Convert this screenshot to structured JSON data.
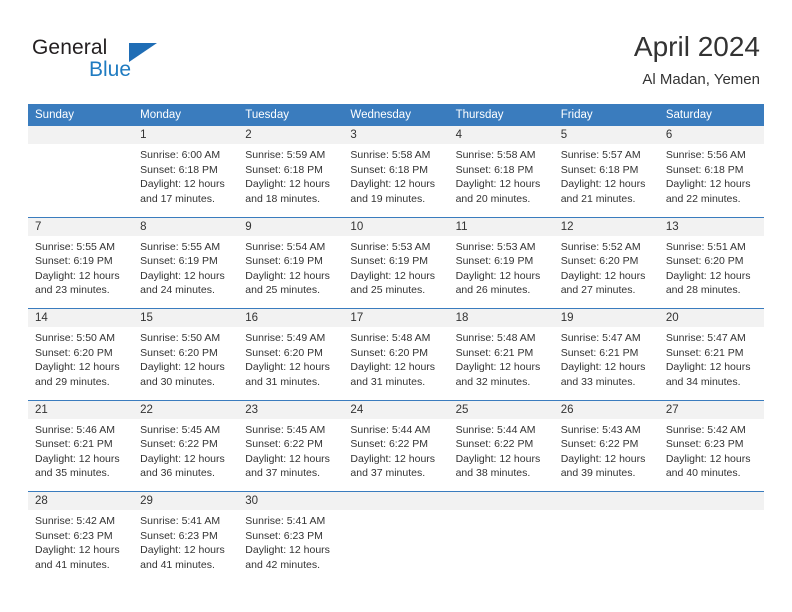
{
  "brand": {
    "name_part1": "General",
    "name_part2": "Blue"
  },
  "header": {
    "title": "April 2024",
    "subtitle": "Al Madan, Yemen"
  },
  "colors": {
    "header_blue": "#3a7cbe",
    "date_strip": "#f2f2f2",
    "logo_blue": "#1f7bc1",
    "text": "#333333"
  },
  "weekday_headers": [
    "Sunday",
    "Monday",
    "Tuesday",
    "Wednesday",
    "Thursday",
    "Friday",
    "Saturday"
  ],
  "labels": {
    "sunrise_prefix": "Sunrise:",
    "sunset_prefix": "Sunset:",
    "daylight_prefix": "Daylight:"
  },
  "weeks": [
    {
      "days": [
        {
          "date": "",
          "sunrise": "",
          "sunset": "",
          "daylight": ""
        },
        {
          "date": "1",
          "sunrise": "Sunrise: 6:00 AM",
          "sunset": "Sunset: 6:18 PM",
          "daylight": "Daylight: 12 hours and 17 minutes."
        },
        {
          "date": "2",
          "sunrise": "Sunrise: 5:59 AM",
          "sunset": "Sunset: 6:18 PM",
          "daylight": "Daylight: 12 hours and 18 minutes."
        },
        {
          "date": "3",
          "sunrise": "Sunrise: 5:58 AM",
          "sunset": "Sunset: 6:18 PM",
          "daylight": "Daylight: 12 hours and 19 minutes."
        },
        {
          "date": "4",
          "sunrise": "Sunrise: 5:58 AM",
          "sunset": "Sunset: 6:18 PM",
          "daylight": "Daylight: 12 hours and 20 minutes."
        },
        {
          "date": "5",
          "sunrise": "Sunrise: 5:57 AM",
          "sunset": "Sunset: 6:18 PM",
          "daylight": "Daylight: 12 hours and 21 minutes."
        },
        {
          "date": "6",
          "sunrise": "Sunrise: 5:56 AM",
          "sunset": "Sunset: 6:18 PM",
          "daylight": "Daylight: 12 hours and 22 minutes."
        }
      ]
    },
    {
      "days": [
        {
          "date": "7",
          "sunrise": "Sunrise: 5:55 AM",
          "sunset": "Sunset: 6:19 PM",
          "daylight": "Daylight: 12 hours and 23 minutes."
        },
        {
          "date": "8",
          "sunrise": "Sunrise: 5:55 AM",
          "sunset": "Sunset: 6:19 PM",
          "daylight": "Daylight: 12 hours and 24 minutes."
        },
        {
          "date": "9",
          "sunrise": "Sunrise: 5:54 AM",
          "sunset": "Sunset: 6:19 PM",
          "daylight": "Daylight: 12 hours and 25 minutes."
        },
        {
          "date": "10",
          "sunrise": "Sunrise: 5:53 AM",
          "sunset": "Sunset: 6:19 PM",
          "daylight": "Daylight: 12 hours and 25 minutes."
        },
        {
          "date": "11",
          "sunrise": "Sunrise: 5:53 AM",
          "sunset": "Sunset: 6:19 PM",
          "daylight": "Daylight: 12 hours and 26 minutes."
        },
        {
          "date": "12",
          "sunrise": "Sunrise: 5:52 AM",
          "sunset": "Sunset: 6:20 PM",
          "daylight": "Daylight: 12 hours and 27 minutes."
        },
        {
          "date": "13",
          "sunrise": "Sunrise: 5:51 AM",
          "sunset": "Sunset: 6:20 PM",
          "daylight": "Daylight: 12 hours and 28 minutes."
        }
      ]
    },
    {
      "days": [
        {
          "date": "14",
          "sunrise": "Sunrise: 5:50 AM",
          "sunset": "Sunset: 6:20 PM",
          "daylight": "Daylight: 12 hours and 29 minutes."
        },
        {
          "date": "15",
          "sunrise": "Sunrise: 5:50 AM",
          "sunset": "Sunset: 6:20 PM",
          "daylight": "Daylight: 12 hours and 30 minutes."
        },
        {
          "date": "16",
          "sunrise": "Sunrise: 5:49 AM",
          "sunset": "Sunset: 6:20 PM",
          "daylight": "Daylight: 12 hours and 31 minutes."
        },
        {
          "date": "17",
          "sunrise": "Sunrise: 5:48 AM",
          "sunset": "Sunset: 6:20 PM",
          "daylight": "Daylight: 12 hours and 31 minutes."
        },
        {
          "date": "18",
          "sunrise": "Sunrise: 5:48 AM",
          "sunset": "Sunset: 6:21 PM",
          "daylight": "Daylight: 12 hours and 32 minutes."
        },
        {
          "date": "19",
          "sunrise": "Sunrise: 5:47 AM",
          "sunset": "Sunset: 6:21 PM",
          "daylight": "Daylight: 12 hours and 33 minutes."
        },
        {
          "date": "20",
          "sunrise": "Sunrise: 5:47 AM",
          "sunset": "Sunset: 6:21 PM",
          "daylight": "Daylight: 12 hours and 34 minutes."
        }
      ]
    },
    {
      "days": [
        {
          "date": "21",
          "sunrise": "Sunrise: 5:46 AM",
          "sunset": "Sunset: 6:21 PM",
          "daylight": "Daylight: 12 hours and 35 minutes."
        },
        {
          "date": "22",
          "sunrise": "Sunrise: 5:45 AM",
          "sunset": "Sunset: 6:22 PM",
          "daylight": "Daylight: 12 hours and 36 minutes."
        },
        {
          "date": "23",
          "sunrise": "Sunrise: 5:45 AM",
          "sunset": "Sunset: 6:22 PM",
          "daylight": "Daylight: 12 hours and 37 minutes."
        },
        {
          "date": "24",
          "sunrise": "Sunrise: 5:44 AM",
          "sunset": "Sunset: 6:22 PM",
          "daylight": "Daylight: 12 hours and 37 minutes."
        },
        {
          "date": "25",
          "sunrise": "Sunrise: 5:44 AM",
          "sunset": "Sunset: 6:22 PM",
          "daylight": "Daylight: 12 hours and 38 minutes."
        },
        {
          "date": "26",
          "sunrise": "Sunrise: 5:43 AM",
          "sunset": "Sunset: 6:22 PM",
          "daylight": "Daylight: 12 hours and 39 minutes."
        },
        {
          "date": "27",
          "sunrise": "Sunrise: 5:42 AM",
          "sunset": "Sunset: 6:23 PM",
          "daylight": "Daylight: 12 hours and 40 minutes."
        }
      ]
    },
    {
      "days": [
        {
          "date": "28",
          "sunrise": "Sunrise: 5:42 AM",
          "sunset": "Sunset: 6:23 PM",
          "daylight": "Daylight: 12 hours and 41 minutes."
        },
        {
          "date": "29",
          "sunrise": "Sunrise: 5:41 AM",
          "sunset": "Sunset: 6:23 PM",
          "daylight": "Daylight: 12 hours and 41 minutes."
        },
        {
          "date": "30",
          "sunrise": "Sunrise: 5:41 AM",
          "sunset": "Sunset: 6:23 PM",
          "daylight": "Daylight: 12 hours and 42 minutes."
        },
        {
          "date": "",
          "sunrise": "",
          "sunset": "",
          "daylight": ""
        },
        {
          "date": "",
          "sunrise": "",
          "sunset": "",
          "daylight": ""
        },
        {
          "date": "",
          "sunrise": "",
          "sunset": "",
          "daylight": ""
        },
        {
          "date": "",
          "sunrise": "",
          "sunset": "",
          "daylight": ""
        }
      ]
    }
  ]
}
